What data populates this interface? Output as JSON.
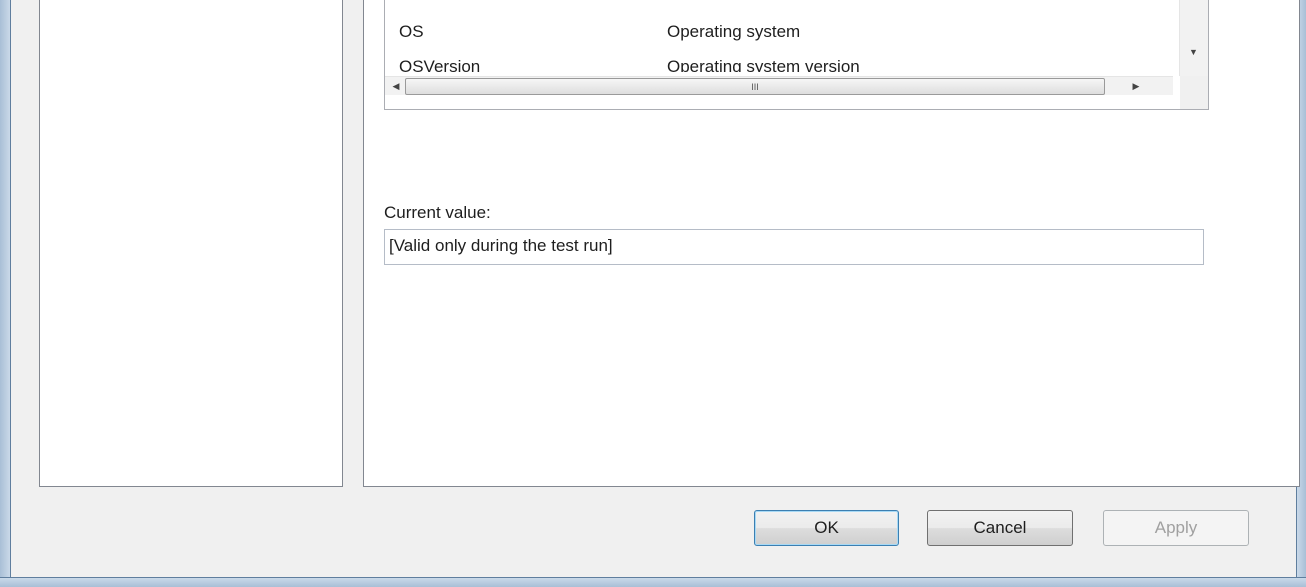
{
  "variables_list": {
    "rows": [
      {
        "name": "OS",
        "description": "Operating system"
      },
      {
        "name": "OSVersion",
        "description": "Operating system version"
      }
    ],
    "hscroll_grip": "III"
  },
  "current_value": {
    "label": "Current value:",
    "value": "[Valid only during the test run]"
  },
  "buttons": {
    "ok": "OK",
    "cancel": "Cancel",
    "apply": "Apply",
    "apply_enabled": false
  },
  "icons": {
    "scroll_left": "left-arrow-icon",
    "scroll_right": "right-arrow-icon",
    "scroll_down": "down-arrow-icon"
  }
}
